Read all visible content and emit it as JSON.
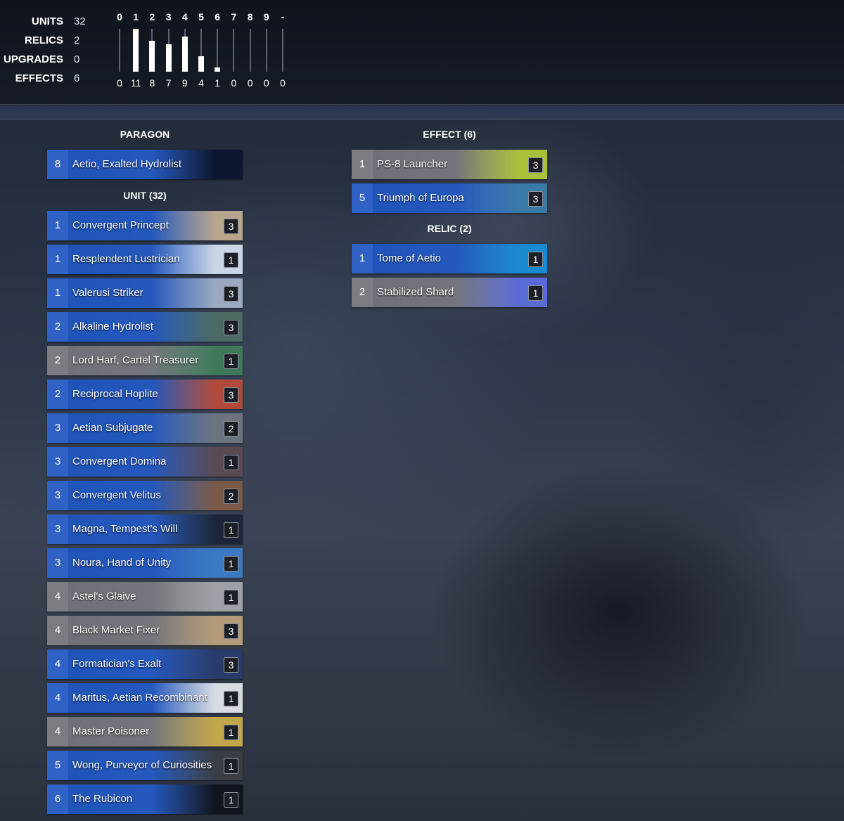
{
  "stats": [
    {
      "label": "UNITS",
      "value": "32"
    },
    {
      "label": "RELICS",
      "value": "2"
    },
    {
      "label": "UPGRADES",
      "value": "0"
    },
    {
      "label": "EFFECTS",
      "value": "6"
    }
  ],
  "mana_curve": {
    "max": 11,
    "columns": [
      {
        "label": "0",
        "count": 0
      },
      {
        "label": "1",
        "count": 11
      },
      {
        "label": "2",
        "count": 8
      },
      {
        "label": "3",
        "count": 7
      },
      {
        "label": "4",
        "count": 9
      },
      {
        "label": "5",
        "count": 4
      },
      {
        "label": "6",
        "count": 1
      },
      {
        "label": "7",
        "count": 0
      },
      {
        "label": "8",
        "count": 0
      },
      {
        "label": "9",
        "count": 0
      },
      {
        "label": "-",
        "count": 0
      }
    ]
  },
  "sections": {
    "paragon": {
      "title": "PARAGON",
      "cards": [
        {
          "cost": "8",
          "name": "Aetio, Exalted Hydrolist",
          "count": "",
          "color": "blue",
          "art": "#0c1630"
        }
      ]
    },
    "unit": {
      "title": "UNIT (32)",
      "cards": [
        {
          "cost": "1",
          "name": "Convergent Princept",
          "count": "3",
          "color": "blue",
          "art": "#b7a58c"
        },
        {
          "cost": "1",
          "name": "Resplendent Lustrician",
          "count": "1",
          "color": "blue",
          "art": "#c9d6e6"
        },
        {
          "cost": "1",
          "name": "Valerusi Striker",
          "count": "3",
          "color": "blue",
          "art": "#9aa8c0"
        },
        {
          "cost": "2",
          "name": "Alkaline Hydrolist",
          "count": "3",
          "color": "blue",
          "art": "#4a6a62"
        },
        {
          "cost": "2",
          "name": "Lord Harf, Cartel Treasurer",
          "count": "1",
          "color": "grey",
          "art": "#3e7a5a"
        },
        {
          "cost": "2",
          "name": "Reciprocal Hoplite",
          "count": "3",
          "color": "blue",
          "art": "#b14a3a"
        },
        {
          "cost": "3",
          "name": "Aetian Subjugate",
          "count": "2",
          "color": "blue",
          "art": "#6d7480"
        },
        {
          "cost": "3",
          "name": "Convergent Domina",
          "count": "1",
          "color": "blue",
          "art": "#5a4a52"
        },
        {
          "cost": "3",
          "name": "Convergent Velitus",
          "count": "2",
          "color": "blue",
          "art": "#7a5a46"
        },
        {
          "cost": "3",
          "name": "Magna, Tempest's Will",
          "count": "1",
          "color": "blue",
          "art": "#1c2638"
        },
        {
          "cost": "3",
          "name": "Noura, Hand of Unity",
          "count": "1",
          "color": "blue",
          "art": "#3a7ac2"
        },
        {
          "cost": "4",
          "name": "Astel's Glaive",
          "count": "1",
          "color": "grey",
          "art": "#9ea2a6"
        },
        {
          "cost": "4",
          "name": "Black Market Fixer",
          "count": "3",
          "color": "grey",
          "art": "#b49a78"
        },
        {
          "cost": "4",
          "name": "Formatician's Exalt",
          "count": "3",
          "color": "blue",
          "art": "#2a3a6a"
        },
        {
          "cost": "4",
          "name": "Maritus, Aetian Recombinant",
          "count": "1",
          "color": "blue",
          "art": "#d8dce2"
        },
        {
          "cost": "4",
          "name": "Master Poisoner",
          "count": "1",
          "color": "grey",
          "art": "#c2a64a"
        },
        {
          "cost": "5",
          "name": "Wong, Purveyor of Curiosities",
          "count": "1",
          "color": "blue",
          "art": "#3a3e44"
        },
        {
          "cost": "6",
          "name": "The Rubicon",
          "count": "1",
          "color": "blue",
          "art": "#10141c"
        }
      ]
    },
    "effect": {
      "title": "EFFECT (6)",
      "cards": [
        {
          "cost": "1",
          "name": "PS-8 Launcher",
          "count": "3",
          "color": "grey",
          "art": "#a8c23a"
        },
        {
          "cost": "5",
          "name": "Triumph of Europa",
          "count": "3",
          "color": "blue",
          "art": "#3a7aa8"
        }
      ]
    },
    "relic": {
      "title": "RELIC (2)",
      "cards": [
        {
          "cost": "1",
          "name": "Tome of Aetio",
          "count": "1",
          "color": "blue",
          "art": "#1a8ad0"
        },
        {
          "cost": "2",
          "name": "Stabilized Shard",
          "count": "1",
          "color": "grey",
          "art": "#5a6ad6"
        }
      ]
    }
  }
}
